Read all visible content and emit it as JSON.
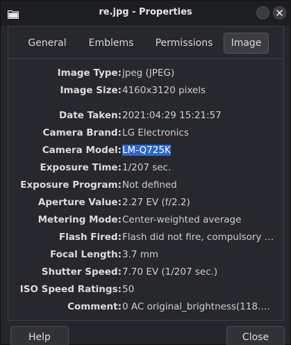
{
  "window": {
    "title": "re.jpg - Properties"
  },
  "tabs": [
    {
      "label": "General"
    },
    {
      "label": "Emblems"
    },
    {
      "label": "Permissions"
    },
    {
      "label": "Image",
      "active": true
    }
  ],
  "properties": [
    {
      "label": "Image Type:",
      "value": "jpeg (JPEG)"
    },
    {
      "label": "Image Size:",
      "value": "4160x3120 pixels"
    },
    {
      "label": "Date Taken:",
      "value": "2021:04:29 15:21:57"
    },
    {
      "label": "Camera Brand:",
      "value": "LG Electronics"
    },
    {
      "label": "Camera Model:",
      "value": "LM-Q725K",
      "selected": true
    },
    {
      "label": "Exposure Time:",
      "value": "1/207 sec."
    },
    {
      "label": "Exposure Program:",
      "value": "Not defined"
    },
    {
      "label": "Aperture Value:",
      "value": "2.27 EV (f/2.2)"
    },
    {
      "label": "Metering Mode:",
      "value": "Center-weighted average"
    },
    {
      "label": "Flash Fired:",
      "value": "Flash did not fire, compulsory …"
    },
    {
      "label": "Focal Length:",
      "value": "3.7 mm"
    },
    {
      "label": "Shutter Speed:",
      "value": "7.70 EV (1/207 sec.)"
    },
    {
      "label": "ISO Speed Ratings:",
      "value": "50"
    },
    {
      "label": "Comment:",
      "value": "0  AC original_brightness(118.…"
    }
  ],
  "buttons": {
    "help": "Help",
    "close": "Close"
  },
  "colors": {
    "selection": "#2f67c9",
    "background": "#24262b"
  },
  "icons": {
    "app": "folder-icon",
    "minimize": "minimize-icon",
    "close": "close-icon"
  }
}
